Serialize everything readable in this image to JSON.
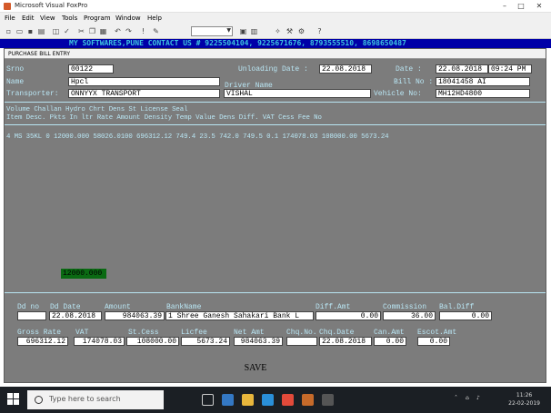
{
  "window": {
    "title": "Microsoft Visual FoxPro",
    "minimize": "–",
    "maximize": "□",
    "close": "✕"
  },
  "menu": [
    "File",
    "Edit",
    "View",
    "Tools",
    "Program",
    "Window",
    "Help"
  ],
  "banner": "MY SOFTWARES,PUNE CONTACT US # 9225504104, 9225671676, 8793555510, 8698650487",
  "form": {
    "title": "PURCHASE BILL ENTRY",
    "srno_label": "Srno",
    "srno_value": "00122",
    "unloading_label": "Unloading Date :",
    "unloading_value": "22.08.2018",
    "date_label": "Date :",
    "date_value": "22.08.2018",
    "time_value": "09:24 PM",
    "name_label": "Name",
    "name_value": "Hpcl",
    "bill_label": "Bill No :",
    "bill_value": "18041458 AI",
    "driver_label": "Driver Name",
    "driver_value": "VISHAL",
    "transporter_label": "Transporter:",
    "transporter_value": "ONNYYX TRANSPORT",
    "vehicle_label": "Vehicle No:",
    "vehicle_value": "MH12HD4800",
    "grid_header": {
      "line1": "                    Volume                          Challan   Hydro Chrt Dens              St        License  Seal",
      "line2": "Item Desc. Pkts In ltr     Rate         Amount  Density Temp Value Dens Diff. VAT        Cess      Fee      No"
    },
    "grid_row": "4 MS 35KL      0 12000.000  58026.0100  696312.12  749.4 23.5  742.0  749.5   0.1  174078.03  108000.00  5673.24",
    "green_value": "12000.000",
    "bottom": {
      "dd_no_label": "Dd no",
      "dd_date_label": "Dd Date",
      "dd_date_value": "22.08.2018",
      "amount_label": "Amount",
      "amount_value": "984063.39",
      "bankname_label": "BankName",
      "bankname_value": "1 Shree Ganesh Sahakari Bank L",
      "diffamt_label": "Diff.Amt",
      "diffamt_value": "0.00",
      "commission_label": "Commission",
      "commission_value": "36.00",
      "baldiff_label": "Bal.Diff",
      "baldiff_value": "0.00",
      "grossrate_label": "Gross Rate",
      "grossrate_value": "696312.12",
      "vat_label": "VAT",
      "vat_value": "174078.03",
      "stcess_label": "St.Cess",
      "stcess_value": "108000.00",
      "licfee_label": "Licfee",
      "licfee_value": "5673.24",
      "netamt_label": "Net Amt",
      "netamt_value": "984063.39",
      "chqno_label": "Chq.No.",
      "chqdate_label": "Chq.Date",
      "chqdate_value": "22.08.2018",
      "canamt_label": "Can.Amt",
      "canamt_value": "0.00",
      "escotamt_label": "Escot.Amt",
      "escotamt_value": "0.00"
    },
    "save_label": "SAVE"
  },
  "taskbar": {
    "search_placeholder": "Type here to search",
    "clock_time": "11:26",
    "clock_date": "22-02-2019"
  }
}
